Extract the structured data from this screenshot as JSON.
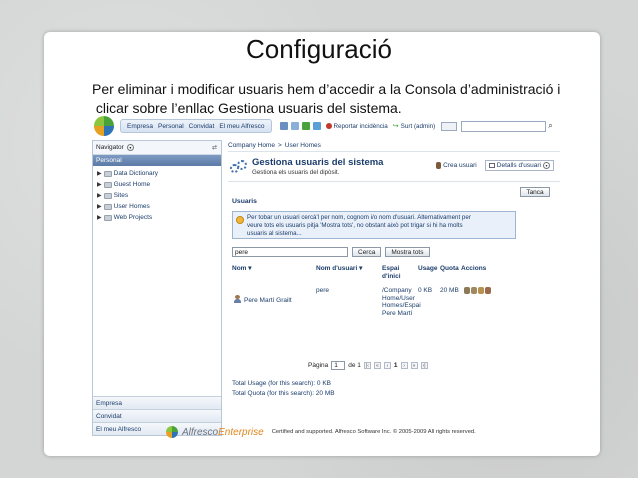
{
  "slide": {
    "title": "Configuració",
    "text_line1": "Per eliminar i modificar usuaris hem d’accedir a la Consola d’administració i",
    "text_line2": " clicar sobre l’enllaç Gestiona usuaris del sistema."
  },
  "toolbar": {
    "tabs": [
      "Empresa",
      "Personal",
      "Convidat",
      "El meu Alfresco"
    ],
    "report": "Reportar incidència",
    "logout": "Surt (admin)"
  },
  "sidebar": {
    "navigator": "Navigator",
    "section": "Personal",
    "items": [
      "Data Dictionary",
      "Guest Home",
      "Sites",
      "User Homes",
      "Web Projects"
    ],
    "bottom": [
      "Empresa",
      "Convidat",
      "El meu Alfresco"
    ]
  },
  "breadcrumb": {
    "home": "Company Home",
    "sep": ">",
    "current": "User Homes"
  },
  "page": {
    "title": "Gestiona usuaris del sistema",
    "subtitle": "Gestiona els usuaris del dipòsit.",
    "create_user": "Crea usuari",
    "details": "Detalls d'usuari",
    "close": "Tanca"
  },
  "users": {
    "panel_title": "Usuaris",
    "info_line1": "Per tobar un usuari cercà'l per nom, cognom i/o nom d'usuari. Alternativament per",
    "info_line2": "veure tots els usuaris pitja 'Mostra tots', no obstant això pot trigar si hi ha molts",
    "info_line3": "usuaris al sistema...",
    "search_value": "pere",
    "search_button": "Cerca",
    "show_all_button": "Mostra tots",
    "columns": {
      "name": "Nom",
      "username": "Nom d'usuari",
      "space_1": "Espai",
      "space_2": "d'inici",
      "usage": "Usage",
      "quota": "Quota",
      "actions": "Accions"
    },
    "row": {
      "name": "Pere Martí Grailt",
      "username": "pere",
      "space_1": "/Company",
      "space_2": "Home/User",
      "space_3": "Homes/Espai",
      "space_4": "Pere Martí",
      "usage": "0 KB",
      "quota": "20 MB"
    },
    "pager": {
      "label": "Pàgina",
      "value": "1",
      "of": "de 1",
      "current": "1"
    },
    "total_usage": "Total Usage (for this search): 0 KB",
    "total_quota": "Total Quota (for this search): 20 MB"
  },
  "footer": {
    "brand1": "Alfresco",
    "brand2": "Enterprise",
    "text": "Certified and supported. Alfresco Software Inc. © 2005-2009 All rights reserved."
  },
  "colors": {
    "accent_orange": "#e0861b",
    "link_blue": "#1c3d6b",
    "section_blue": "#5b7aa6"
  }
}
